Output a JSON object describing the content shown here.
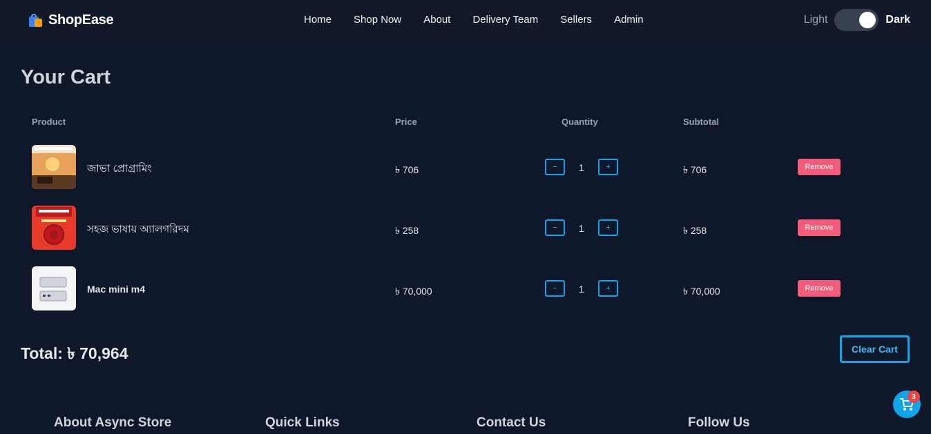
{
  "brand": {
    "name": "ShopEase"
  },
  "nav": {
    "links": [
      "Home",
      "Shop Now",
      "About",
      "Delivery Team",
      "Sellers",
      "Admin"
    ]
  },
  "theme": {
    "light_label": "Light",
    "dark_label": "Dark",
    "mode": "dark"
  },
  "cart": {
    "title": "Your Cart",
    "columns": {
      "product": "Product",
      "price": "Price",
      "quantity": "Quantity",
      "subtotal": "Subtotal"
    },
    "items": [
      {
        "name": "জাভা প্রোগ্রামিং",
        "price": "৳ 706",
        "quantity": "1",
        "subtotal": "৳ 706",
        "remove_label": "Remove",
        "minus": "−",
        "plus": "+"
      },
      {
        "name": "সহজ ভাষায় অ্যালগরিদম",
        "price": "৳ 258",
        "quantity": "1",
        "subtotal": "৳ 258",
        "remove_label": "Remove",
        "minus": "−",
        "plus": "+"
      },
      {
        "name": "Mac mini m4",
        "price": "৳ 70,000",
        "quantity": "1",
        "subtotal": "৳ 70,000",
        "remove_label": "Remove",
        "minus": "−",
        "plus": "+"
      }
    ],
    "total_label": "Total:",
    "total_value": "৳ 70,964",
    "clear_label": "Clear Cart"
  },
  "footer": {
    "headings": [
      "About Async Store",
      "Quick Links",
      "Contact Us",
      "Follow Us"
    ]
  },
  "floating_cart": {
    "count": "3"
  },
  "colors": {
    "background": "#0f172a",
    "navbar": "#111827",
    "accent": "#0ea5e9",
    "remove": "#f25c7a",
    "badge": "#ef4444"
  }
}
